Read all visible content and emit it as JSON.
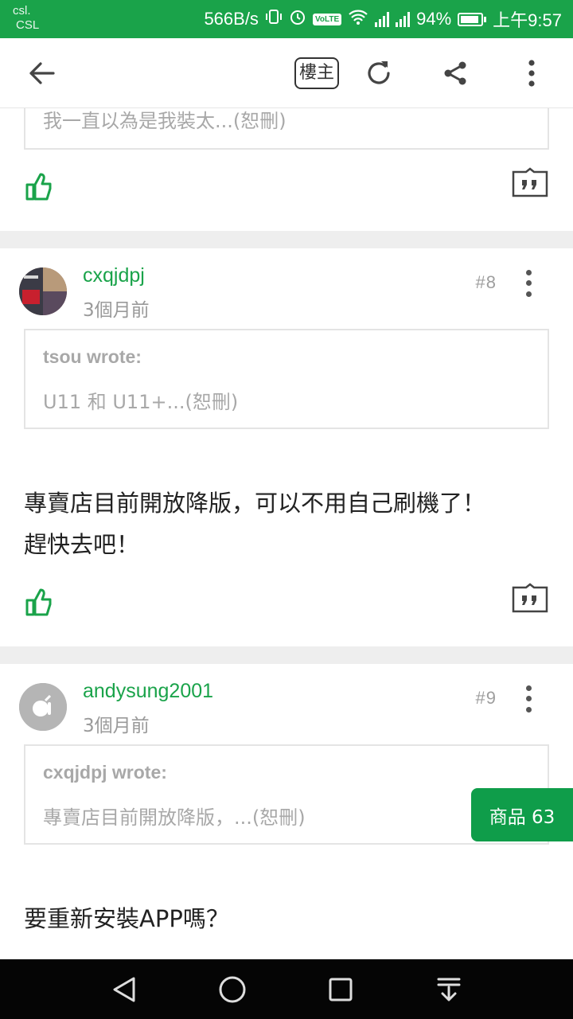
{
  "status_bar": {
    "carrier_line1": "csl.",
    "carrier_line2": "CSL",
    "net_speed": "566B/s",
    "volte": "VoLTE",
    "battery": "94%",
    "time": "上午9:57"
  },
  "app_bar": {
    "back_icon": "arrow-left-icon",
    "op_filter_label": "樓主",
    "refresh_icon": "refresh-icon",
    "share_icon": "share-icon",
    "more_icon": "more-vertical-icon"
  },
  "posts": [
    {
      "quote_text": "我一直以為是我裝太...(恕刪)"
    },
    {
      "username": "cxqjdpj",
      "time": "3個月前",
      "floor": "#8",
      "quote_author": "tsou wrote:",
      "quote_text": "U11 和 U11+...(恕刪)",
      "body_line1": "專賣店目前開放降版，可以不用自己刷機了！",
      "body_line2": "趕快去吧！"
    },
    {
      "username": "andysung2001",
      "time": "3個月前",
      "floor": "#9",
      "quote_author": "cxqjdpj wrote:",
      "quote_text": "專賣店目前開放降版，...(恕刪)",
      "body_line1": "要重新安裝APP嗎？"
    }
  ],
  "goods_tab": "商品 63",
  "colors": {
    "brand_green": "#1aa34a",
    "goods_green": "#0f9d4a"
  }
}
